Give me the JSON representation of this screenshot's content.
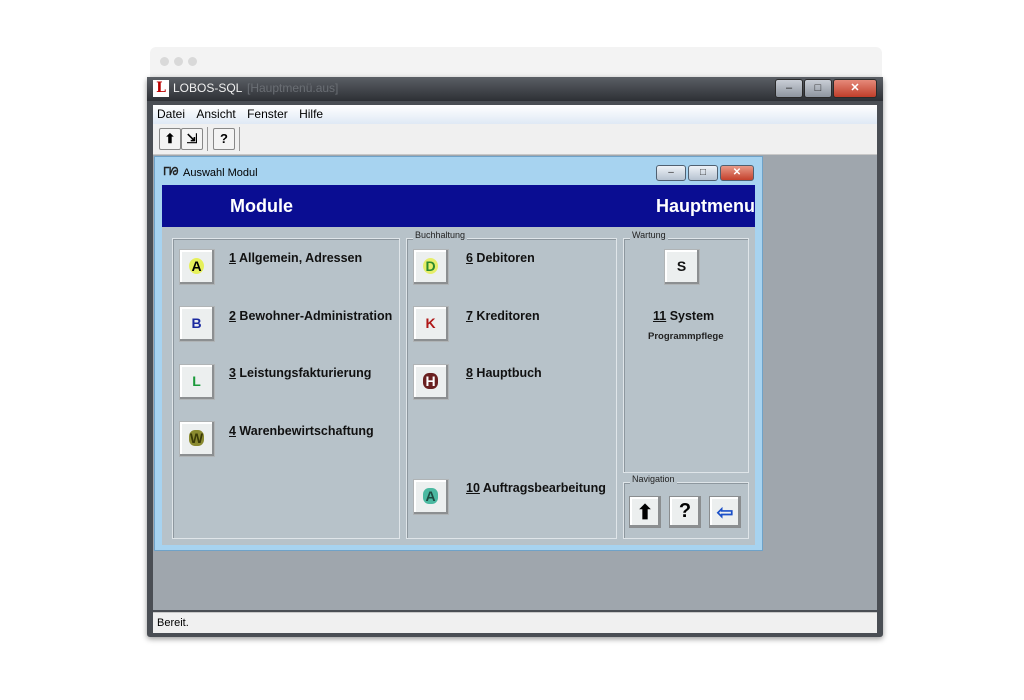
{
  "app": {
    "title": "LOBOS-SQL",
    "document": "[Hauptmenü.aus]",
    "window_buttons": {
      "minimize": "–",
      "maximize": "□",
      "close": "✕"
    }
  },
  "menu": [
    {
      "label": "Datei"
    },
    {
      "label": "Ansicht"
    },
    {
      "label": "Fenster"
    },
    {
      "label": "Hilfe"
    }
  ],
  "toolbar": {
    "up_glyph": "⬆",
    "exit_glyph": "⇲",
    "help_glyph": "?"
  },
  "status": {
    "text": "Bereit."
  },
  "child_window": {
    "title": "Auswahl Modul",
    "icon_glyph": "ᒥᘙ",
    "banner_left": "Module",
    "banner_right": "Hauptmenu"
  },
  "modules_left": [
    {
      "num": "1",
      "label": " Allgemein, Adressen",
      "letter": "A",
      "color": "#c9c900"
    },
    {
      "num": "2",
      "label": " Bewohner-Administration",
      "letter": "B",
      "color": "#1b2aa0"
    },
    {
      "num": "3",
      "label": " Leistungsfakturierung",
      "letter": "L",
      "color": "#1a9a3a"
    },
    {
      "num": "4",
      "label": " Warenbewirtschaftung",
      "letter": "W",
      "color": "#5a5a10"
    }
  ],
  "buchhaltung": {
    "label": "Buchhaltung",
    "modules": [
      {
        "num": "6",
        "label": " Debitoren",
        "letter": "D",
        "color": "#2c8a2c"
      },
      {
        "num": "7",
        "label": " Kreditoren",
        "letter": "K",
        "color": "#b01818"
      },
      {
        "num": "8",
        "label": " Hauptbuch",
        "letter": "H",
        "color": "#6a2020"
      },
      {
        "num": "10",
        "label": " Auftragsbearbeitung",
        "letter": "A",
        "color": "#3a9a8a"
      }
    ]
  },
  "wartung": {
    "label": "Wartung",
    "letter": "S",
    "num": "11",
    "title": " System",
    "subtitle": "Programmpflege"
  },
  "navigation": {
    "label": "Navigation",
    "up_glyph": "⬆",
    "help_glyph": "?",
    "exit_glyph": "⇦"
  }
}
